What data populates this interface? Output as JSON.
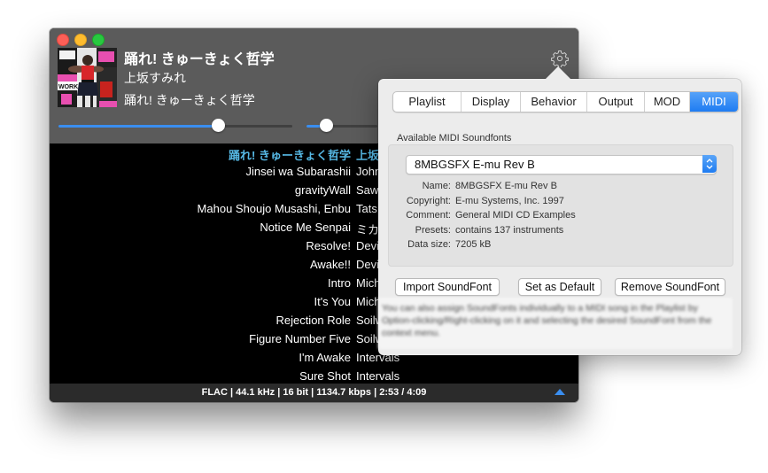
{
  "player": {
    "now_playing": {
      "title": "踊れ! きゅーきょく哲学",
      "artist": "上坂すみれ",
      "album": "踊れ! きゅーきょく哲学",
      "artwork": "album-artwork"
    },
    "seek_progress": 0.68,
    "volume_level": 0.28,
    "settings_icon": "gear-icon",
    "playlist": [
      {
        "title": "踊れ! きゅーきょく哲学",
        "artist": "上坂",
        "current": true
      },
      {
        "title": "Jinsei wa Subarashii",
        "artist": "John"
      },
      {
        "title": "gravityWall",
        "artist": "Saw"
      },
      {
        "title": "Mahou Shoujo Musashi, Enbu",
        "artist": "Tats"
      },
      {
        "title": "Notice Me Senpai",
        "artist": "ミカ"
      },
      {
        "title": "Resolve!",
        "artist": "Devi"
      },
      {
        "title": "Awake!!",
        "artist": "Devi"
      },
      {
        "title": "Intro",
        "artist": "Mich"
      },
      {
        "title": "It's You",
        "artist": "Mich"
      },
      {
        "title": "Rejection Role",
        "artist": "Soilw"
      },
      {
        "title": "Figure Number Five",
        "artist": "Soilw"
      },
      {
        "title": "I'm Awake",
        "artist": "Intervals"
      },
      {
        "title": "Sure Shot",
        "artist": "Intervals"
      }
    ],
    "status": "FLAC | 44.1 kHz | 16 bit | 1134.7 kbps | 2:53 / 4:09",
    "accent_color": "#3a8ef0",
    "current_track_color": "#56b8e4"
  },
  "preferences": {
    "tabs": [
      {
        "label": "Playlist",
        "active": false
      },
      {
        "label": "Display",
        "active": false
      },
      {
        "label": "Behavior",
        "active": false
      },
      {
        "label": "Output",
        "active": false
      },
      {
        "label": "MOD",
        "active": false
      },
      {
        "label": "MIDI",
        "active": true
      }
    ],
    "section_label": "Available MIDI Soundfonts",
    "soundfont_select": "8MBGSFX E-mu Rev B",
    "info": [
      {
        "key": "Name:",
        "value": "8MBGSFX E-mu Rev B"
      },
      {
        "key": "Copyright:",
        "value": "E-mu Systems, Inc. 1997"
      },
      {
        "key": "Comment:",
        "value": "General MIDI CD Examples"
      },
      {
        "key": "Presets:",
        "value": "contains 137 instruments"
      },
      {
        "key": "Data size:",
        "value": "7205 kB"
      }
    ],
    "buttons": {
      "import": "Import SoundFont",
      "default": "Set as Default",
      "remove": "Remove SoundFont"
    },
    "hint": "You can also assign SoundFonts individually to a MIDI song in the Playlist by Option-clicking/Right-clicking on it and selecting the desired SoundFont from the context menu."
  }
}
